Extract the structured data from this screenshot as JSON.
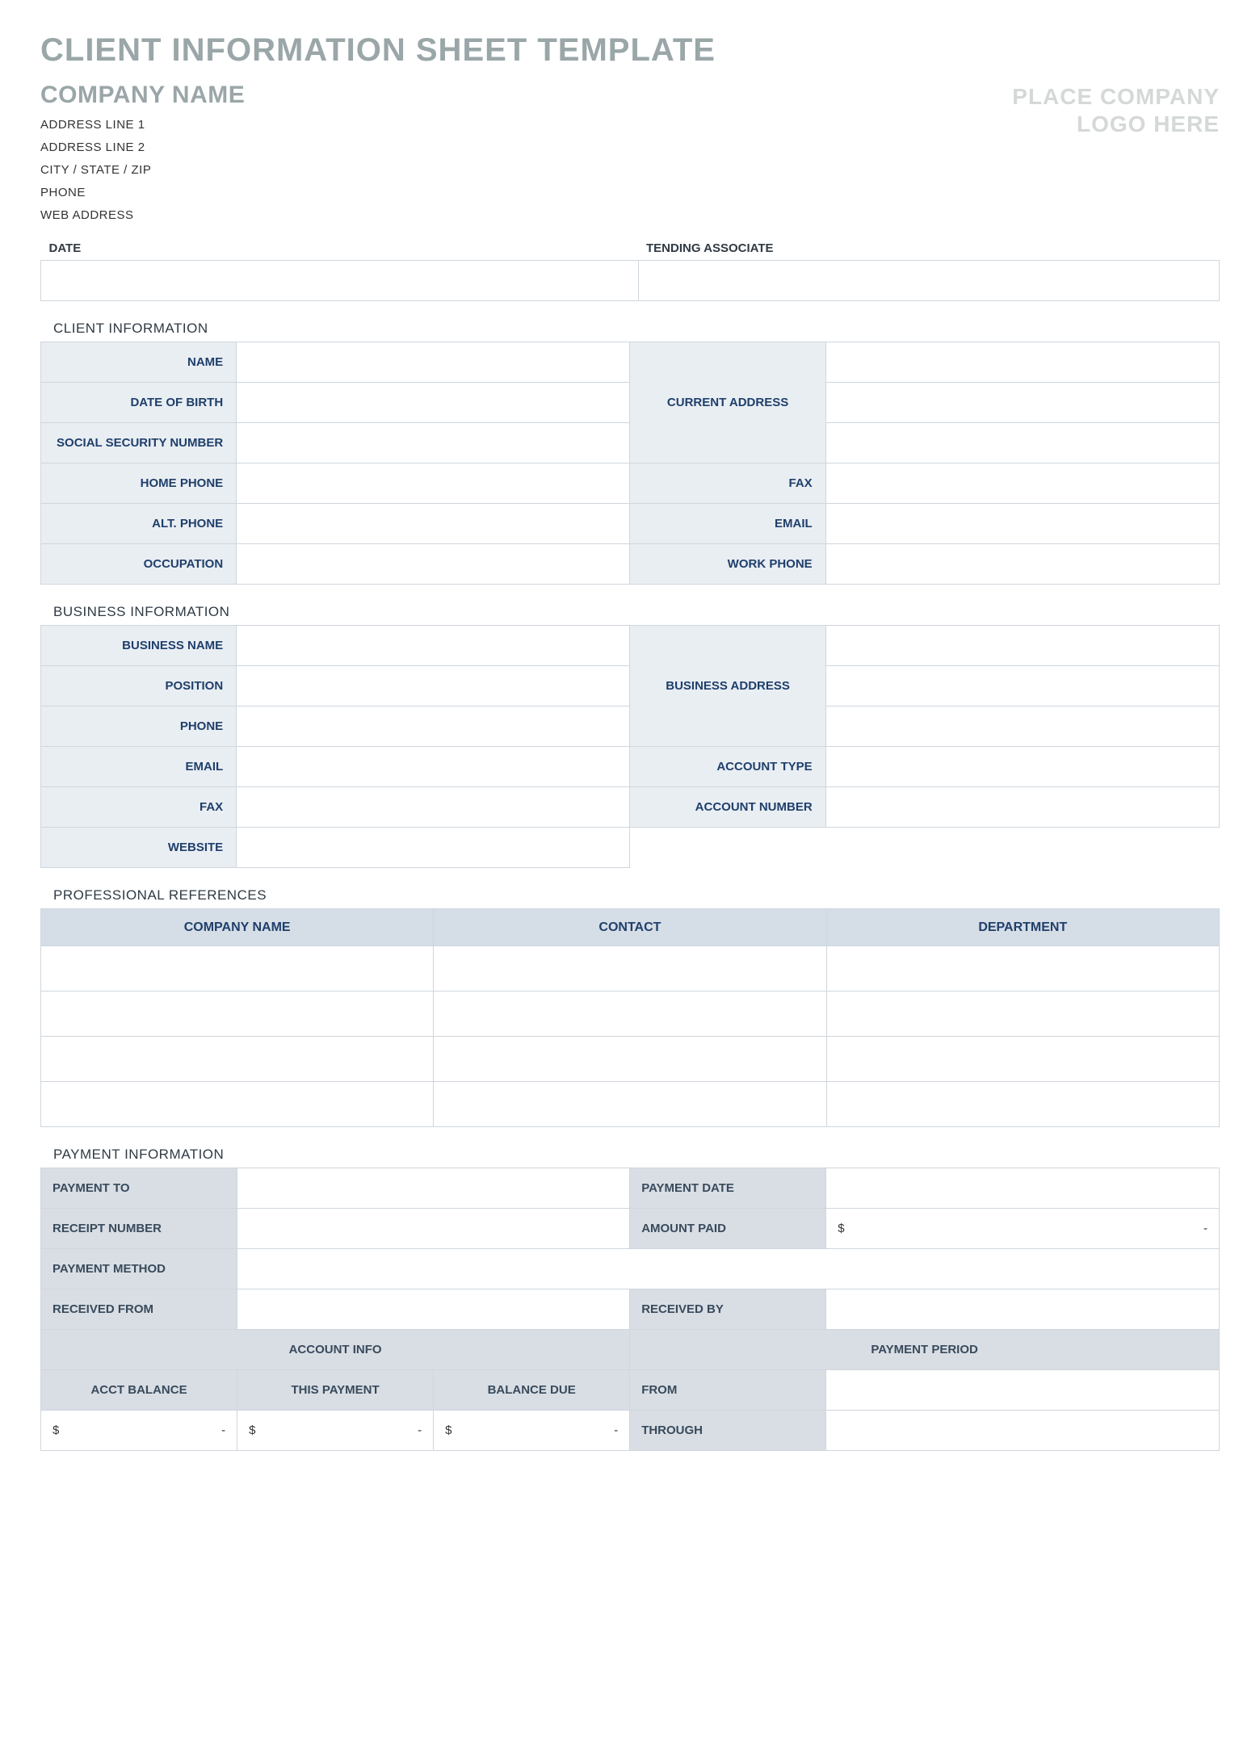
{
  "title": "CLIENT INFORMATION SHEET TEMPLATE",
  "company": {
    "name_label": "COMPANY NAME",
    "address1": "ADDRESS LINE 1",
    "address2": "ADDRESS LINE 2",
    "csz": "CITY / STATE / ZIP",
    "phone": "PHONE",
    "web": "WEB ADDRESS"
  },
  "logo_placeholder_line1": "PLACE COMPANY",
  "logo_placeholder_line2": "LOGO HERE",
  "meta": {
    "date_label": "DATE",
    "tending_associate_label": "TENDING ASSOCIATE",
    "date_value": "",
    "tending_associate_value": ""
  },
  "client_info": {
    "section_label": "CLIENT INFORMATION",
    "name_label": "NAME",
    "dob_label": "DATE OF BIRTH",
    "ssn_label": "SOCIAL SECURITY NUMBER",
    "home_phone_label": "HOME PHONE",
    "alt_phone_label": "ALT. PHONE",
    "occupation_label": "OCCUPATION",
    "current_address_label": "CURRENT ADDRESS",
    "fax_label": "FAX",
    "email_label": "EMAIL",
    "work_phone_label": "WORK PHONE"
  },
  "business_info": {
    "section_label": "BUSINESS INFORMATION",
    "business_name_label": "BUSINESS NAME",
    "position_label": "POSITION",
    "phone_label": "PHONE",
    "email_label": "EMAIL",
    "fax_label": "FAX",
    "website_label": "WEBSITE",
    "business_address_label": "BUSINESS ADDRESS",
    "account_type_label": "ACCOUNT TYPE",
    "account_number_label": "ACCOUNT NUMBER"
  },
  "references": {
    "section_label": "PROFESSIONAL REFERENCES",
    "company_header": "COMPANY NAME",
    "contact_header": "CONTACT",
    "department_header": "DEPARTMENT"
  },
  "payment": {
    "section_label": "PAYMENT INFORMATION",
    "payment_to_label": "PAYMENT TO",
    "receipt_number_label": "RECEIPT NUMBER",
    "payment_method_label": "PAYMENT METHOD",
    "received_from_label": "RECEIVED FROM",
    "payment_date_label": "PAYMENT DATE",
    "amount_paid_label": "AMOUNT PAID",
    "received_by_label": "RECEIVED BY",
    "amount_paid_currency": "$",
    "amount_paid_value": "-",
    "account_info_header": "ACCOUNT INFO",
    "payment_period_header": "PAYMENT PERIOD",
    "acct_balance_label": "ACCT BALANCE",
    "this_payment_label": "THIS PAYMENT",
    "balance_due_label": "BALANCE DUE",
    "from_label": "FROM",
    "through_label": "THROUGH",
    "acct_balance_currency": "$",
    "acct_balance_value": "-",
    "this_payment_currency": "$",
    "this_payment_value": "-",
    "balance_due_currency": "$",
    "balance_due_value": "-"
  }
}
